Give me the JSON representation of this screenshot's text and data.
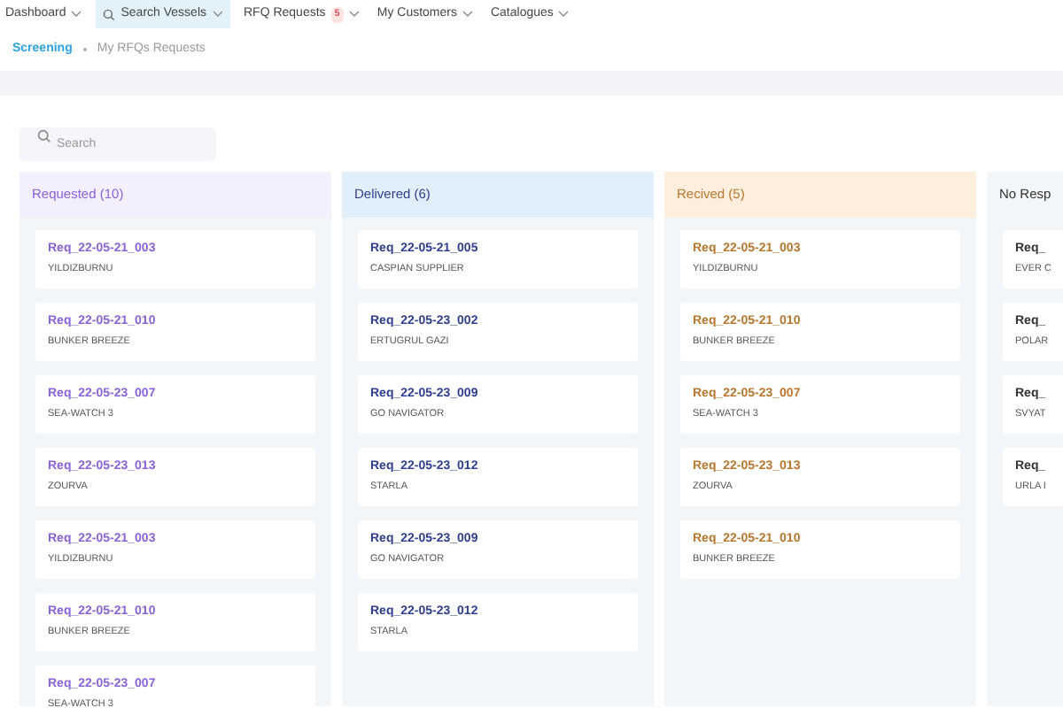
{
  "nav": [
    {
      "label": "Dashboard",
      "selected": false
    },
    {
      "label": "Search Vessels",
      "selected": true,
      "search_icon": true
    },
    {
      "label": "RFQ Requests",
      "selected": false,
      "badge": "5"
    },
    {
      "label": "My Customers",
      "selected": false
    },
    {
      "label": "Catalogues",
      "selected": false
    }
  ],
  "breadcrumb": [
    {
      "label": "Screening",
      "selected": true
    },
    {
      "label": "My RFQs Requests",
      "selected": false
    }
  ],
  "search": {
    "placeholder": "Search"
  },
  "columns": [
    {
      "kind": "requested",
      "title": "Requested (10)",
      "cards": [
        {
          "id": "Req_22-05-21_003",
          "vessel": "YILDIZBURNU"
        },
        {
          "id": "Req_22-05-21_010",
          "vessel": "BUNKER BREEZE"
        },
        {
          "id": "Req_22-05-23_007",
          "vessel": "SEA-WATCH 3"
        },
        {
          "id": "Req_22-05-23_013",
          "vessel": "ZOURVA"
        },
        {
          "id": "Req_22-05-21_003",
          "vessel": "YILDIZBURNU"
        },
        {
          "id": "Req_22-05-21_010",
          "vessel": "BUNKER BREEZE"
        },
        {
          "id": "Req_22-05-23_007",
          "vessel": "SEA-WATCH 3"
        }
      ]
    },
    {
      "kind": "delivered",
      "title": "Delivered (6)",
      "cards": [
        {
          "id": "Req_22-05-21_005",
          "vessel": "CASPIAN SUPPLIER"
        },
        {
          "id": "Req_22-05-23_002",
          "vessel": "ERTUGRUL GAZI"
        },
        {
          "id": "Req_22-05-23_009",
          "vessel": "GO NAVIGATOR"
        },
        {
          "id": "Req_22-05-23_012",
          "vessel": "STARLA"
        },
        {
          "id": "Req_22-05-23_009",
          "vessel": "GO NAVIGATOR"
        },
        {
          "id": "Req_22-05-23_012",
          "vessel": "STARLA"
        }
      ]
    },
    {
      "kind": "received",
      "title": "Recived (5)",
      "cards": [
        {
          "id": "Req_22-05-21_003",
          "vessel": "YILDIZBURNU"
        },
        {
          "id": "Req_22-05-21_010",
          "vessel": "BUNKER BREEZE"
        },
        {
          "id": "Req_22-05-23_007",
          "vessel": "SEA-WATCH 3"
        },
        {
          "id": "Req_22-05-23_013",
          "vessel": "ZOURVA"
        },
        {
          "id": "Req_22-05-21_010",
          "vessel": "BUNKER BREEZE"
        }
      ]
    },
    {
      "kind": "no_response",
      "title": "No Resp",
      "cards": [
        {
          "id": "Req_",
          "vessel": "EVER C"
        },
        {
          "id": "Req_",
          "vessel": "POLAR"
        },
        {
          "id": "Req_",
          "vessel": "SVYAT"
        },
        {
          "id": "Req_",
          "vessel": "URLA I"
        }
      ]
    }
  ]
}
